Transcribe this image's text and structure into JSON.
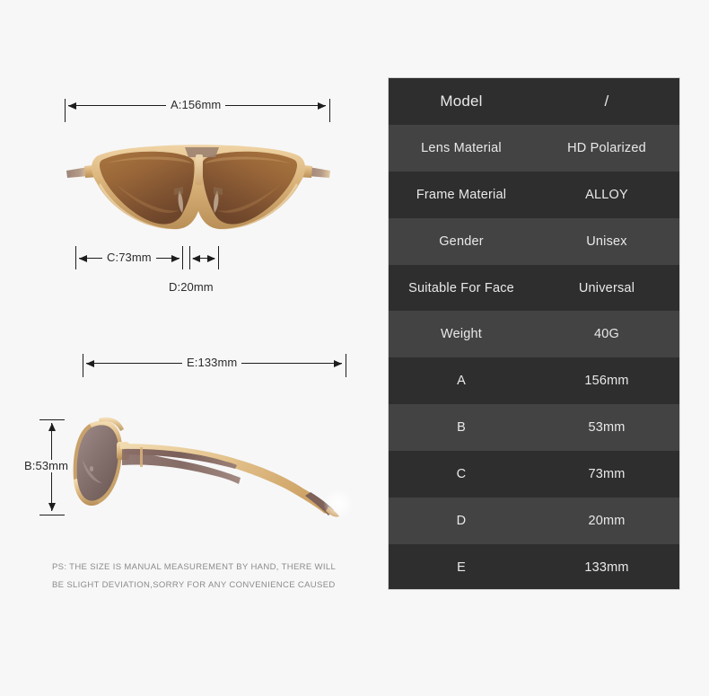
{
  "background_color": "#f7f7f7",
  "product": {
    "type": "sunglasses",
    "front_view_alt": "Aviator sunglasses front view with brown gradient lenses and gold alloy frame",
    "side_view_alt": "Aviator sunglasses side profile view with gold temple arm",
    "lens_color": "#9a6a44",
    "frame_color": "#e0bd8a"
  },
  "dimensions": {
    "a": {
      "label": "A:156mm",
      "code": "A",
      "value": "156mm"
    },
    "b": {
      "label": "B:53mm",
      "code": "B",
      "value": "53mm"
    },
    "c": {
      "label": "C:73mm",
      "code": "C",
      "value": "73mm"
    },
    "d": {
      "label": "D:20mm",
      "code": "D",
      "value": "20mm"
    },
    "e": {
      "label": "E:133mm",
      "code": "E",
      "value": "133mm"
    }
  },
  "note": {
    "line1": "PS: THE SIZE IS MANUAL MEASUREMENT BY HAND, THERE WILL",
    "line2": "BE SLIGHT DEVIATION,SORRY FOR ANY CONVENIENCE CAUSED"
  },
  "spec_table": {
    "row_color_odd": "#2e2e2e",
    "row_color_even": "#434343",
    "rows": [
      {
        "label": "Model",
        "value": "/"
      },
      {
        "label": "Lens Material",
        "value": "HD Polarized"
      },
      {
        "label": "Frame Material",
        "value": "ALLOY"
      },
      {
        "label": "Gender",
        "value": "Unisex"
      },
      {
        "label": "Suitable For Face",
        "value": "Universal"
      },
      {
        "label": "Weight",
        "value": "40G"
      },
      {
        "label": "A",
        "value": "156mm"
      },
      {
        "label": "B",
        "value": "53mm"
      },
      {
        "label": "C",
        "value": "73mm"
      },
      {
        "label": "D",
        "value": "20mm"
      },
      {
        "label": "E",
        "value": "133mm"
      }
    ]
  }
}
